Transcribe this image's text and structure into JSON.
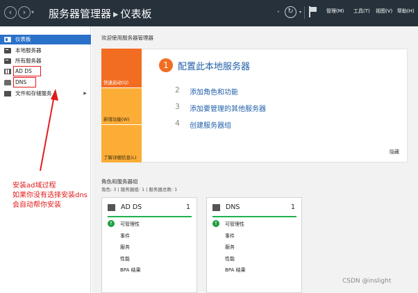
{
  "window": {
    "title_app": "服务器管理器",
    "title_separator": "▸",
    "title_page": "仪表板",
    "menus": [
      "管理(M)",
      "工具(T)",
      "视图(V)",
      "帮助(H)"
    ]
  },
  "sidebar": {
    "items": [
      {
        "label": "仪表板",
        "icon": "dashboard-icon",
        "active": true
      },
      {
        "label": "本地服务器",
        "icon": "server-icon"
      },
      {
        "label": "所有服务器",
        "icon": "servers-icon"
      },
      {
        "label": "AD DS",
        "icon": "ad-ds-icon"
      },
      {
        "label": "DNS",
        "icon": "dns-icon"
      },
      {
        "label": "文件和存储服务",
        "icon": "file-storage-icon",
        "has_children": true
      }
    ]
  },
  "welcome": {
    "heading": "欢迎使用服务器管理器",
    "tabs": [
      "快速启动(Q)",
      "新增功能(W)",
      "了解详细信息(L)"
    ],
    "steps": [
      {
        "num": "1",
        "label": "配置此本地服务器"
      },
      {
        "num": "2",
        "label": "添加角色和功能"
      },
      {
        "num": "3",
        "label": "添加要管理的其他服务器"
      },
      {
        "num": "4",
        "label": "创建服务器组"
      }
    ],
    "hide_label": "隐藏"
  },
  "roles": {
    "heading": "角色和服务器组",
    "summary": "角色: 3 | 服务器组: 1 | 服务器总数: 1",
    "tiles": [
      {
        "name": "AD DS",
        "count": "1",
        "rows": [
          "可管理性",
          "事件",
          "服务",
          "性能",
          "BPA 结果"
        ]
      },
      {
        "name": "DNS",
        "count": "1",
        "rows": [
          "可管理性",
          "事件",
          "服务",
          "性能",
          "BPA 结果"
        ]
      }
    ]
  },
  "annotation": {
    "lines": [
      "安装ad域过程",
      "如果你没有选择安装dns",
      "会自动帮你安装"
    ],
    "color": "#e01b1b"
  },
  "watermark": "CSDN @inslight",
  "colors": {
    "titlebar": "#26313b",
    "accent_blue": "#2a71c9",
    "quickstart_orange": "#f26d22",
    "tab_amber": "#fbad36",
    "status_green": "#21b24b"
  }
}
